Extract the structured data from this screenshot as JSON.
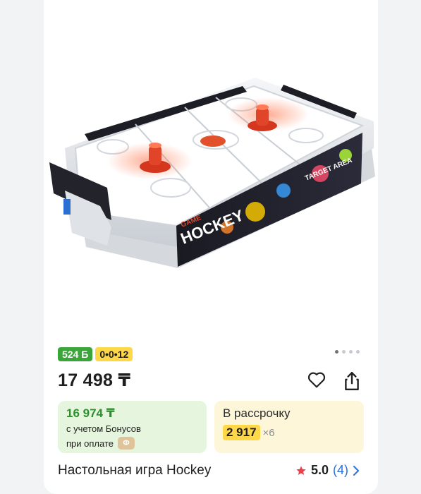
{
  "badges": {
    "bonus": "524 Б",
    "installment": "0•0•12"
  },
  "price": "17 498 ₸",
  "bonus_offer": {
    "price": "16 974 ₸",
    "line1": "с учетом Бонусов",
    "line2": "при оплате",
    "coin_label": "Ф"
  },
  "installment": {
    "title": "В рассрочку",
    "amount": "2 917",
    "multiplier": "×6"
  },
  "product": {
    "title": "Настольная игра Hockey",
    "rating": "5.0",
    "reviews": "(4)",
    "image_text": {
      "game": "GAME",
      "hockey": "HOCKEY",
      "target": "TARGET AREA"
    }
  },
  "carousel": {
    "total": 4,
    "active": 0
  },
  "icons": {
    "favorite": "heart-icon",
    "share": "share-icon",
    "star": "star-icon",
    "chevron": "chevron-right-icon"
  },
  "colors": {
    "green": "#3aa63a",
    "yellow": "#ffd84a",
    "star": "#e8414a",
    "link": "#2a6fdb"
  }
}
